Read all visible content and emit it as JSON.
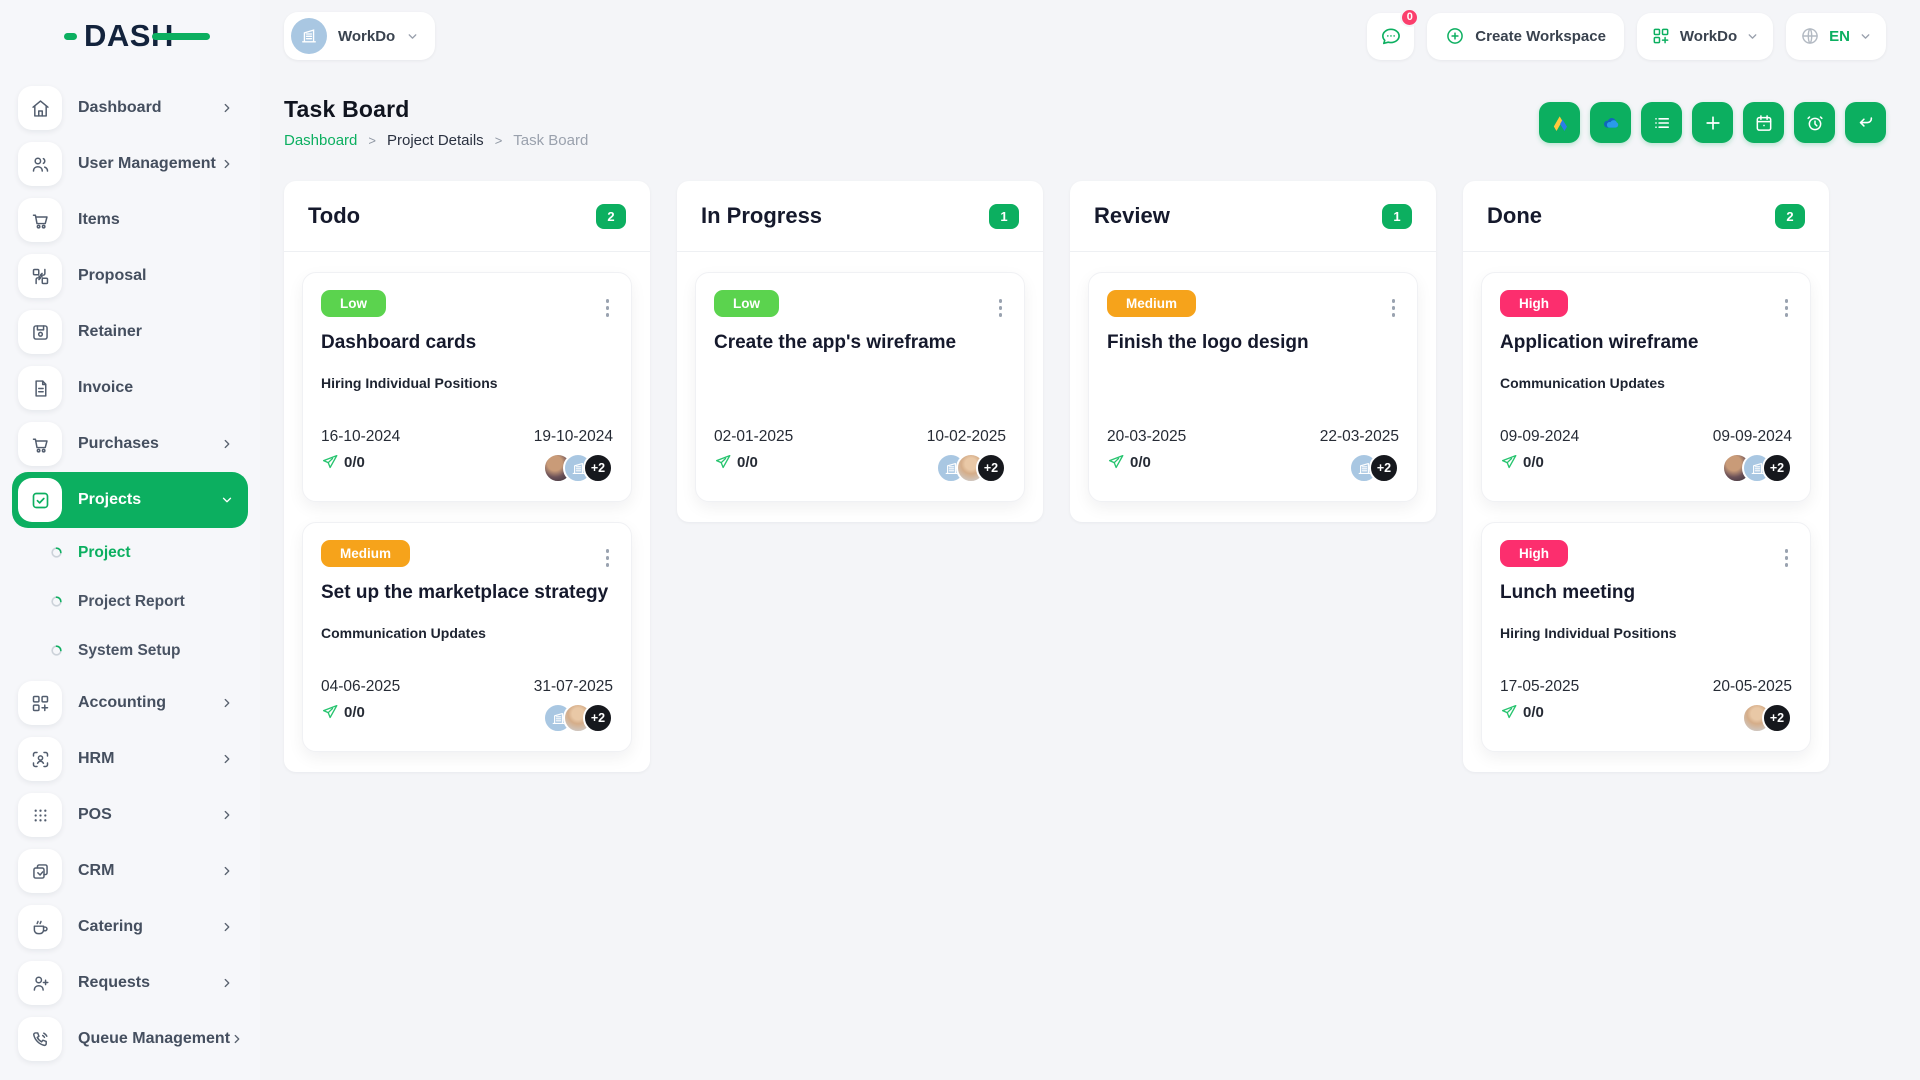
{
  "colors": {
    "accent": "#0caf60",
    "navy": "#13233c",
    "low": "#5bd34e",
    "medium": "#f6a31b",
    "high": "#fc2e6e",
    "badge-pink": "#fb3e6c"
  },
  "brand": {
    "logo_text": "DASH"
  },
  "topbar": {
    "workspace_selector_label": "WorkDo",
    "messages_badge": "0",
    "create_workspace_label": "Create Workspace",
    "workspace_menu_label": "WorkDo",
    "language_label": "EN"
  },
  "sidebar": {
    "items": [
      {
        "label": "Dashboard",
        "icon": "home-icon",
        "chevron": "right"
      },
      {
        "label": "User Management",
        "icon": "users-icon",
        "chevron": "right"
      },
      {
        "label": "Items",
        "icon": "items-cart-icon"
      },
      {
        "label": "Proposal",
        "icon": "proposal-icon"
      },
      {
        "label": "Retainer",
        "icon": "retainer-icon"
      },
      {
        "label": "Invoice",
        "icon": "invoice-icon"
      },
      {
        "label": "Purchases",
        "icon": "purchases-cart-icon",
        "chevron": "right"
      },
      {
        "label": "Projects",
        "icon": "projects-check-icon",
        "chevron": "down",
        "active": true,
        "children": [
          {
            "label": "Project",
            "active": true
          },
          {
            "label": "Project Report"
          },
          {
            "label": "System Setup"
          }
        ]
      },
      {
        "label": "Accounting",
        "icon": "accounting-icon",
        "chevron": "right"
      },
      {
        "label": "HRM",
        "icon": "hrm-icon",
        "chevron": "right"
      },
      {
        "label": "POS",
        "icon": "pos-icon",
        "chevron": "right"
      },
      {
        "label": "CRM",
        "icon": "crm-icon",
        "chevron": "right"
      },
      {
        "label": "Catering",
        "icon": "catering-icon",
        "chevron": "right"
      },
      {
        "label": "Requests",
        "icon": "requests-icon",
        "chevron": "right"
      },
      {
        "label": "Queue Management",
        "icon": "queue-icon",
        "chevron": "right"
      }
    ]
  },
  "page": {
    "title": "Task Board",
    "breadcrumb": [
      {
        "label": "Dashboard",
        "type": "link"
      },
      {
        "label": "Project Details",
        "type": "dark"
      },
      {
        "label": "Task Board",
        "type": "current"
      }
    ],
    "toolbar": [
      "google-drive-icon",
      "onedrive-icon",
      "list-icon",
      "plus-icon",
      "calendar-icon",
      "alarm-icon",
      "undo-icon"
    ]
  },
  "board": {
    "columns": [
      {
        "name": "Todo",
        "count": "2",
        "cards": [
          {
            "priority": "Low",
            "priority_level": "low",
            "title": "Dashboard cards",
            "subtitle": "Hiring Individual Positions",
            "start_date": "16-10-2024",
            "end_date": "19-10-2024",
            "progress": "0/0",
            "avatars": [
              "user-photo-1",
              "workspace-logo"
            ],
            "extra_count": "+2"
          },
          {
            "priority": "Medium",
            "priority_level": "medium",
            "title": "Set up the marketplace strategy",
            "subtitle": "Communication Updates",
            "start_date": "04-06-2025",
            "end_date": "31-07-2025",
            "progress": "0/0",
            "avatars": [
              "workspace-logo",
              "user-photo-2"
            ],
            "extra_count": "+2"
          }
        ]
      },
      {
        "name": "In Progress",
        "count": "1",
        "cards": [
          {
            "priority": "Low",
            "priority_level": "low",
            "title": "Create the app's wireframe",
            "subtitle": "",
            "start_date": "02-01-2025",
            "end_date": "10-02-2025",
            "progress": "0/0",
            "avatars": [
              "workspace-logo",
              "user-photo-2"
            ],
            "extra_count": "+2"
          }
        ]
      },
      {
        "name": "Review",
        "count": "1",
        "cards": [
          {
            "priority": "Medium",
            "priority_level": "medium",
            "title": "Finish the logo design",
            "subtitle": "",
            "start_date": "20-03-2025",
            "end_date": "22-03-2025",
            "progress": "0/0",
            "avatars": [
              "workspace-logo"
            ],
            "extra_count": "+2"
          }
        ]
      },
      {
        "name": "Done",
        "count": "2",
        "cards": [
          {
            "priority": "High",
            "priority_level": "high",
            "title": "Application wireframe",
            "subtitle": "Communication Updates",
            "start_date": "09-09-2024",
            "end_date": "09-09-2024",
            "progress": "0/0",
            "avatars": [
              "user-photo-1",
              "workspace-logo"
            ],
            "extra_count": "+2"
          },
          {
            "priority": "High",
            "priority_level": "high",
            "title": "Lunch meeting",
            "subtitle": "Hiring Individual Positions",
            "start_date": "17-05-2025",
            "end_date": "20-05-2025",
            "progress": "0/0",
            "avatars": [
              "user-photo-2"
            ],
            "extra_count": "+2"
          }
        ]
      }
    ]
  }
}
